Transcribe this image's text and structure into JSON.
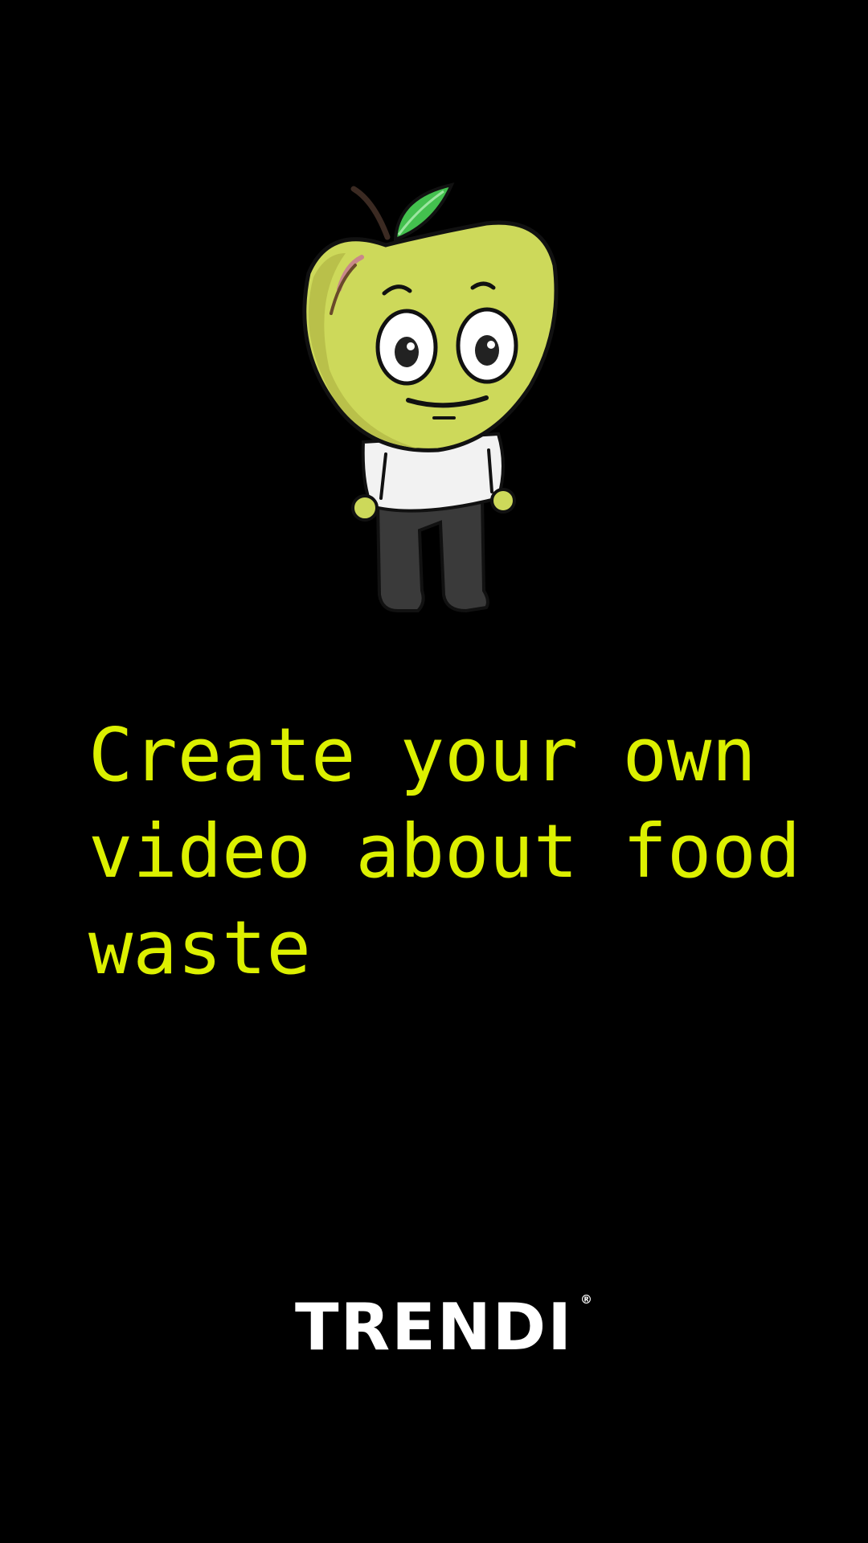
{
  "colors": {
    "background": "#000000",
    "headline": "#dcf000",
    "brand": "#ffffff",
    "apple_body": "#cdd95a",
    "apple_shade": "#b9c04a",
    "leaf": "#43c04e",
    "shirt": "#f2f2f2",
    "pants": "#3a3a3a"
  },
  "mascot": {
    "icon": "apple-mascot-icon"
  },
  "headline": {
    "text": "Create your own\nvideo about food\nwaste"
  },
  "brand": {
    "name": "TRENDI",
    "mark": "®"
  }
}
